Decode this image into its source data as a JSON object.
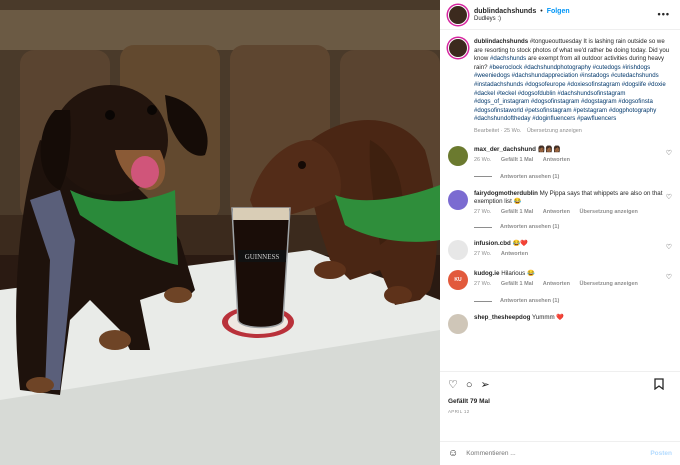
{
  "post": {
    "username": "dublindachshunds",
    "location": "Dudleys :)",
    "dot": "•",
    "follow_label": "Folgen",
    "more_label": "•••",
    "caption_prefix": "#tongueouttuesday It is lashing rain outside so we are resorting to stock photos of what we'd rather be doing today. Did you know",
    "caption_tag1": "#dachshunds",
    "caption_mid": "are exempt from all outdoor activities during heavy rain?",
    "caption_tags": "#beeroclock #dachshundphotography #cutedogs #irishdogs #weeniedogs #dachshundappreciation #instadogs #cutedachshunds #instadachshunds #dogsofeurope #doxiesofinstagram #dogslife #doxie #dackel #teckel #dogsofdublin #dachshundsofinstagram #dogs_of_instagram #dogsofinstagram #dogstagram #dogsofinsta #dogsofinstaworld #petsofinstagram #petstagram #dogphotography #dachshundoftheday #doginfluencers #pawfluencers",
    "caption_meta_edited": "Bearbeitet · 25 Wo.",
    "caption_meta_translate": "Übersetzung anzeigen",
    "likes": "Gefällt 79 Mal",
    "date": "APRIL 12",
    "add_comment_placeholder": "Kommentieren ...",
    "post_label": "Posten",
    "image_glass_brand": "GUINNESS"
  },
  "comments": [
    {
      "user": "max_der_dachshund",
      "text": "👩🏾👩🏾👩🏾",
      "age": "26 Wo.",
      "likes": "Gefällt 1 Mal",
      "reply": "Antworten",
      "translate": "",
      "replies": "Antworten ansehen (1)"
    },
    {
      "user": "fairydogmotherdublin",
      "text": "My Pippa says that whippets are also on that exemption list 😂",
      "age": "27 Wo.",
      "likes": "Gefällt 1 Mal",
      "reply": "Antworten",
      "translate": "Übersetzung anzeigen",
      "replies": "Antworten ansehen (1)"
    },
    {
      "user": "infusion.cbd",
      "text": "😂❤️",
      "age": "27 Wo.",
      "likes": "",
      "reply": "Antworten",
      "translate": "",
      "replies": ""
    },
    {
      "user": "kudog.ie",
      "text": "Hilarious 😂",
      "age": "27 Wo.",
      "likes": "Gefällt 1 Mal",
      "reply": "Antworten",
      "translate": "Übersetzung anzeigen",
      "replies": "Antworten ansehen (1)"
    },
    {
      "user": "shep_thesheepdog",
      "text": "Yummm ❤️",
      "age": "",
      "likes": "",
      "reply": "",
      "translate": "",
      "replies": ""
    }
  ],
  "avatar_badge_kudog": "KU",
  "icons": {
    "like": "heart-outline-icon",
    "comment": "comment-bubble-icon",
    "share": "paper-plane-icon",
    "save": "bookmark-icon",
    "emoji": "smiley-icon",
    "more": "more-dots-icon"
  }
}
